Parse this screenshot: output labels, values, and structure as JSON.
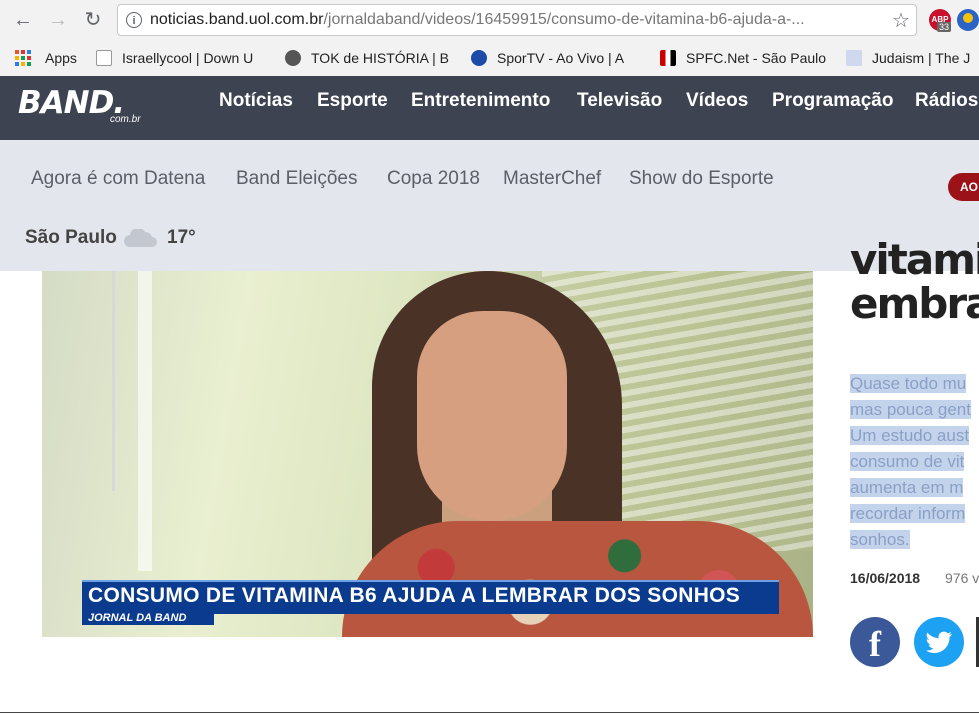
{
  "browser": {
    "url_domain": "noticias.band.uol.com.br",
    "url_path": "/jornaldaband/videos/16459915/consumo-de-vitamina-b6-ajuda-a-...",
    "extension_badge_text": "ABP",
    "extension_badge_count": "33",
    "back_icon": "←",
    "forward_icon": "→",
    "reload_icon": "↻",
    "star_icon": "☆",
    "bookmarks": [
      {
        "label": "Apps"
      },
      {
        "label": "Israellycool | Down U"
      },
      {
        "label": "TOK de HISTÓRIA | B"
      },
      {
        "label": "SporTV - Ao Vivo | A"
      },
      {
        "label": "SPFC.Net - São Paulo"
      },
      {
        "label": "Judaism | The J"
      }
    ]
  },
  "site": {
    "logo": "BAND.",
    "logo_sub": "com.br",
    "main_nav": [
      "Notícias",
      "Esporte",
      "Entretenimento",
      "Televisão",
      "Vídeos",
      "Programação",
      "Rádios"
    ],
    "sub_nav": [
      "Agora é com Datena",
      "Band Eleições",
      "Copa 2018",
      "MasterChef",
      "Show do Esporte"
    ],
    "live_pill": "AO",
    "weather": {
      "city": "São Paulo",
      "temp": "17°",
      "icon": "cloud-icon"
    }
  },
  "video": {
    "caption": "CONSUMO DE VITAMINA B6 AJUDA A LEMBRAR DOS SONHOS",
    "program_tag": "JORNAL DA BAND"
  },
  "article": {
    "headline_line1": "vitamir",
    "headline_line2": "embrar",
    "summary_lines": [
      "Quase todo mu",
      "mas pouca gent",
      "Um estudo aust",
      "consumo de vit",
      "aumenta em m",
      "recordar inform",
      "sonhos."
    ],
    "date": "16/06/2018",
    "views": "976 v",
    "facebook_glyph": "f",
    "colors": {
      "header": "#3d4350",
      "subnav": "#e3e6ec",
      "caption_bar": "#0b3b8f",
      "facebook": "#3b5998",
      "twitter": "#1da1f2"
    }
  }
}
